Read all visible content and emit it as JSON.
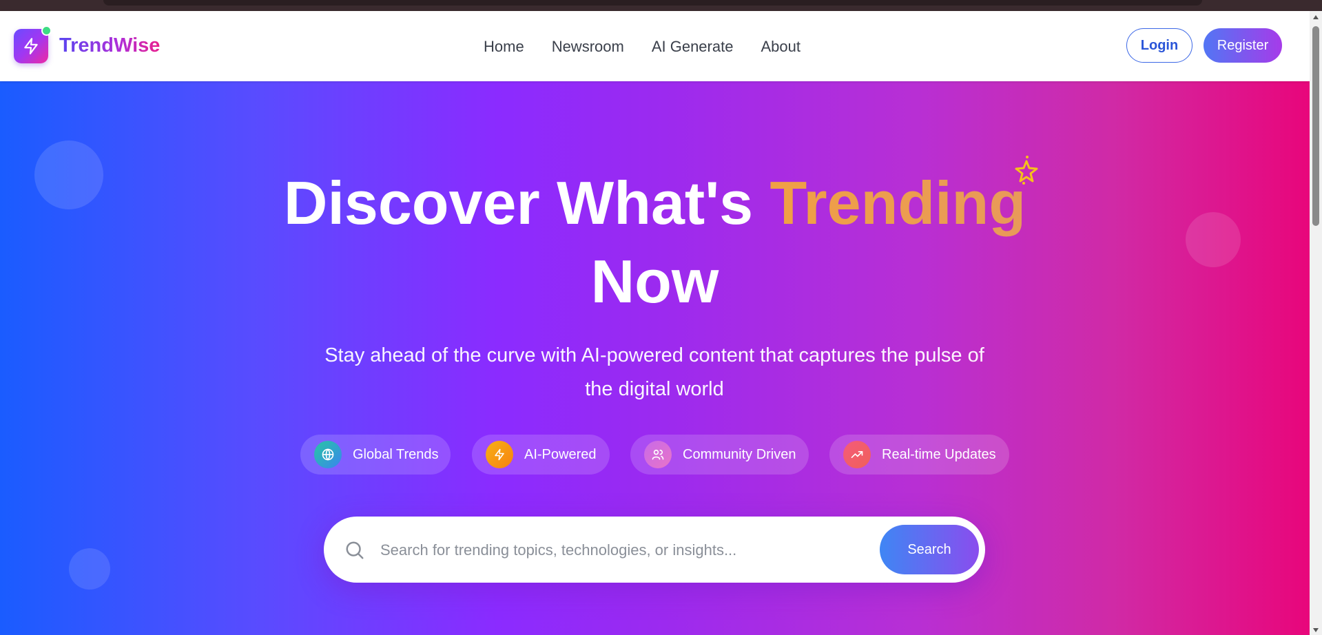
{
  "header": {
    "brand": "TrendWise",
    "nav": [
      "Home",
      "Newsroom",
      "AI Generate",
      "About"
    ],
    "login_label": "Login",
    "register_label": "Register"
  },
  "hero": {
    "headline_part1": "Discover What's ",
    "headline_highlight": "Trending",
    "headline_part2": "Now",
    "subtitle": "Stay ahead of the curve with AI-powered content that captures the pulse of the digital world",
    "features": [
      {
        "label": "Global Trends",
        "icon": "globe-icon"
      },
      {
        "label": "AI-Powered",
        "icon": "lightning-icon"
      },
      {
        "label": "Community Driven",
        "icon": "users-icon"
      },
      {
        "label": "Real-time Updates",
        "icon": "trending-up-icon"
      }
    ]
  },
  "search": {
    "placeholder": "Search for trending topics, technologies, or insights...",
    "button_label": "Search"
  },
  "colors": {
    "brand_start": "#5a45f0",
    "brand_end": "#e8208e",
    "hero_left": "#1a5cff",
    "hero_mid": "#9b2af0",
    "hero_right": "#e8067b",
    "highlight": "#f0a044",
    "status_dot": "#3ddc84"
  }
}
